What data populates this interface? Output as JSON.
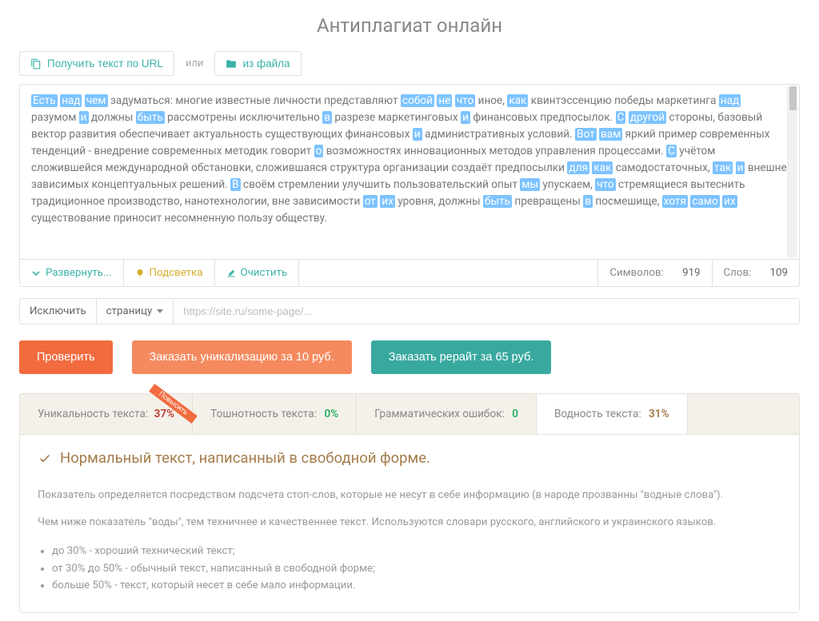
{
  "title": "Антиплагиат онлайн",
  "topBar": {
    "getByUrl": "Получить текст по URL",
    "or": "или",
    "fromFile": "из файла"
  },
  "text": {
    "parts": [
      {
        "hl": true,
        "t": "Есть"
      },
      {
        "hl": true,
        "t": "над"
      },
      {
        "hl": true,
        "t": "чем"
      },
      {
        "hl": false,
        "t": " задуматься: многие известные личности представляют "
      },
      {
        "hl": true,
        "t": "собой"
      },
      {
        "hl": true,
        "t": "не"
      },
      {
        "hl": true,
        "t": "что"
      },
      {
        "hl": false,
        "t": " иное, "
      },
      {
        "hl": true,
        "t": "как"
      },
      {
        "hl": false,
        "t": " квинтэссенцию победы маркетинга "
      },
      {
        "hl": true,
        "t": "над"
      },
      {
        "hl": false,
        "t": " разумом "
      },
      {
        "hl": true,
        "t": "и"
      },
      {
        "hl": false,
        "t": " должны "
      },
      {
        "hl": true,
        "t": "быть"
      },
      {
        "hl": false,
        "t": " рассмотрены исключительно "
      },
      {
        "hl": true,
        "t": "в"
      },
      {
        "hl": false,
        "t": " разрезе маркетинговых "
      },
      {
        "hl": true,
        "t": "и"
      },
      {
        "hl": false,
        "t": " финансовых предпосылок. "
      },
      {
        "hl": true,
        "t": "С"
      },
      {
        "hl": true,
        "t": "другой"
      },
      {
        "hl": false,
        "t": " стороны, базовый вектор развития обеспечивает актуальность существующих финансовых "
      },
      {
        "hl": true,
        "t": "и"
      },
      {
        "hl": false,
        "t": " административных условий. "
      },
      {
        "hl": true,
        "t": "Вот"
      },
      {
        "hl": true,
        "t": "вам"
      },
      {
        "hl": false,
        "t": " яркий пример современных тенденций - внедрение современных методик говорит "
      },
      {
        "hl": true,
        "t": "о"
      },
      {
        "hl": false,
        "t": " возможностях инновационных методов управления процессами. "
      },
      {
        "hl": true,
        "t": "С"
      },
      {
        "hl": false,
        "t": " учётом сложившейся международной обстановки, сложившаяся структура организации создаёт предпосылки "
      },
      {
        "hl": true,
        "t": "для"
      },
      {
        "hl": true,
        "t": "как"
      },
      {
        "hl": false,
        "t": " самодостаточных, "
      },
      {
        "hl": true,
        "t": "так"
      },
      {
        "hl": true,
        "t": "и"
      },
      {
        "hl": false,
        "t": " внешне зависимых концептуальных решений. "
      },
      {
        "hl": true,
        "t": "В"
      },
      {
        "hl": false,
        "t": " своём стремлении улучшить пользовательский опыт "
      },
      {
        "hl": true,
        "t": "мы"
      },
      {
        "hl": false,
        "t": " упускаем, "
      },
      {
        "hl": true,
        "t": "что"
      },
      {
        "hl": false,
        "t": " стремящиеся вытеснить традиционное производство, нанотехнологии, вне зависимости "
      },
      {
        "hl": true,
        "t": "от"
      },
      {
        "hl": true,
        "t": "их"
      },
      {
        "hl": false,
        "t": " уровня, должны "
      },
      {
        "hl": true,
        "t": "быть"
      },
      {
        "hl": false,
        "t": " превращены "
      },
      {
        "hl": true,
        "t": "в"
      },
      {
        "hl": false,
        "t": " посмешище, "
      },
      {
        "hl": true,
        "t": "хотя"
      },
      {
        "hl": true,
        "t": "само"
      },
      {
        "hl": true,
        "t": "их"
      },
      {
        "hl": false,
        "t": " существование приносит несомненную пользу обществу."
      }
    ]
  },
  "toolbar": {
    "expand": "Развернуть...",
    "highlight": "Подсветка",
    "clear": "Очистить",
    "charsLabel": "Символов:",
    "charsVal": "919",
    "wordsLabel": "Слов:",
    "wordsVal": "109"
  },
  "exclude": {
    "label": "Исключить",
    "pageSel": "страницу",
    "placeholder": "https://site.ru/some-page/..."
  },
  "actions": {
    "check": "Проверить",
    "unique": "Заказать уникализацию за 10 руб.",
    "rewrite": "Заказать рерайт за 65 руб."
  },
  "tabs": {
    "unique": {
      "label": "Уникальность текста:",
      "val": "37%",
      "ribbon": "Повысить"
    },
    "nausea": {
      "label": "Тошнотность текста:",
      "val": "0%"
    },
    "grammar": {
      "label": "Грамматических ошибок:",
      "val": "0"
    },
    "water": {
      "label": "Водность текста:",
      "val": "31%"
    }
  },
  "results": {
    "heading": "Нормальный текст, написанный в свободной форме.",
    "p1": "Показатель определяется посредством подсчета стоп-слов, которые не несут в себе информацию (в народе прозванны \"водные слова\").",
    "p2": "Чем ниже показатель \"воды\", тем техничнее и качественнее текст. Используются словари русского, английского и украинского языков.",
    "li1": "до 30% - хороший технический текст;",
    "li2": "от 30% до 50% - обычный текст, написанный в свободной форме;",
    "li3": "больше 50% - текст, который несет в себе мало информации."
  }
}
